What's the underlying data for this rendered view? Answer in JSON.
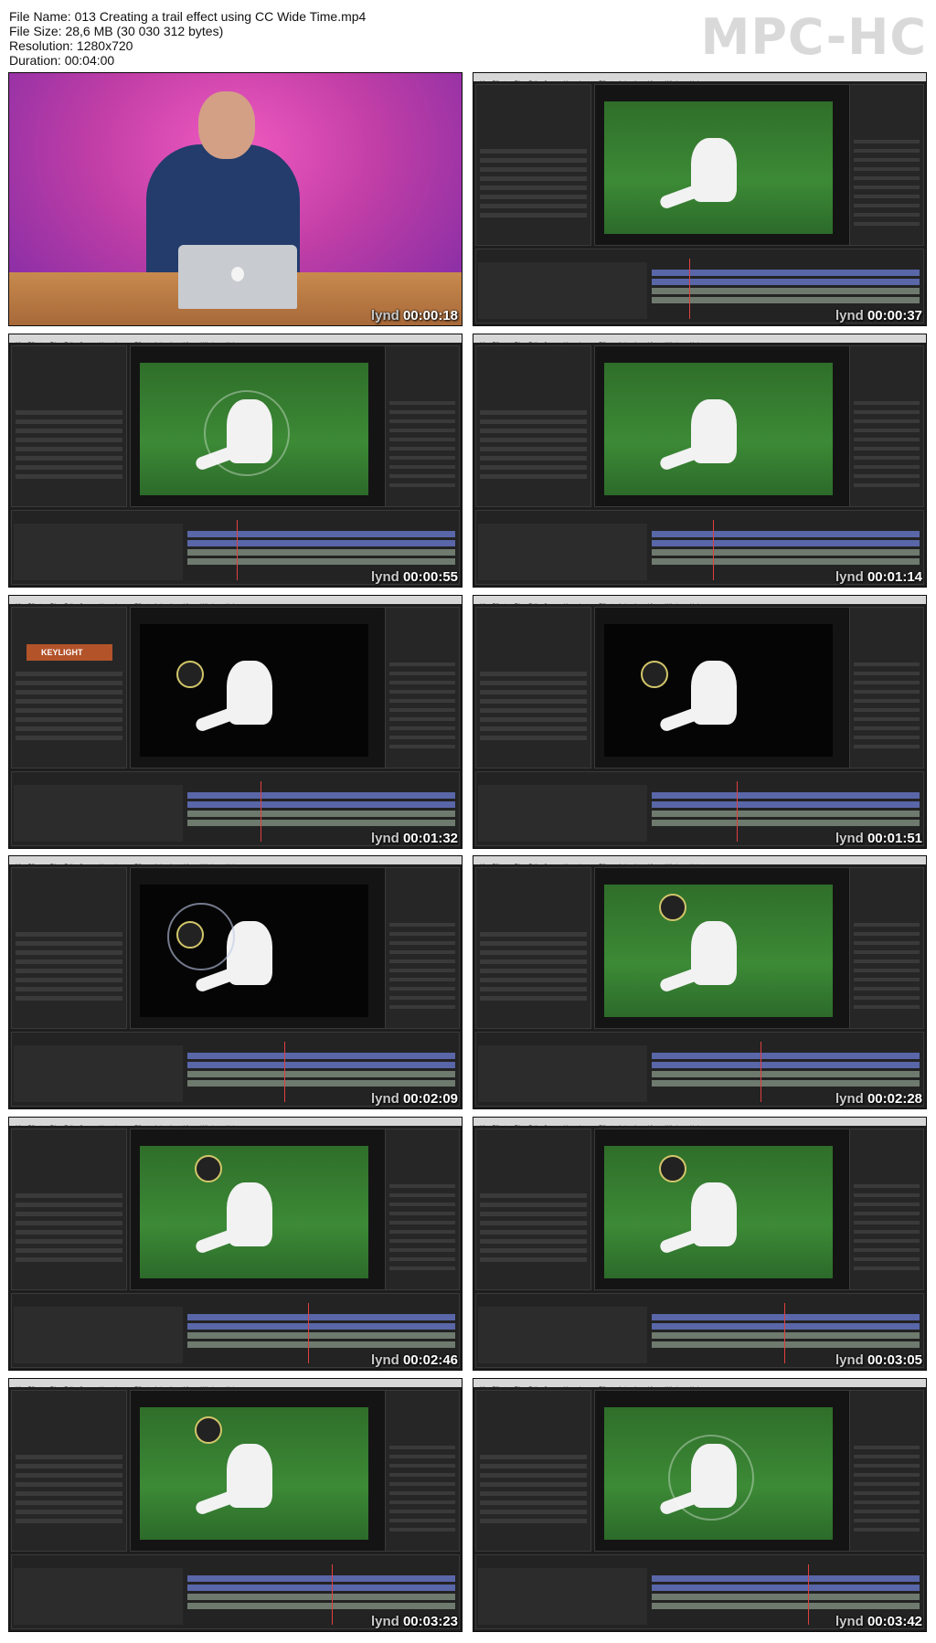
{
  "info": {
    "file_name": "File Name: 013 Creating a trail effect using CC Wide Time.mp4",
    "file_size": "File Size: 28,6 MB (30 030 312 bytes)",
    "resolution": "Resolution: 1280x720",
    "duration": "Duration: 00:04:00"
  },
  "brand": "MPC-HC",
  "ae": {
    "menu": [
      "After Effects",
      "File",
      "Edit",
      "Composition",
      "Layer",
      "Effect",
      "Animation",
      "View",
      "Window",
      "Help"
    ],
    "keylight_label": "KEYLIGHT"
  },
  "watermark": "lynda.com",
  "thumbnails": [
    {
      "time": "00:00:18",
      "scene": "presenter"
    },
    {
      "time": "00:00:37",
      "scene": "grass"
    },
    {
      "time": "00:00:55",
      "scene": "grass-trail"
    },
    {
      "time": "00:01:14",
      "scene": "grass"
    },
    {
      "time": "00:01:32",
      "scene": "black-keylight"
    },
    {
      "time": "00:01:51",
      "scene": "black"
    },
    {
      "time": "00:02:09",
      "scene": "black-circle"
    },
    {
      "time": "00:02:28",
      "scene": "grass-ball"
    },
    {
      "time": "00:02:46",
      "scene": "grass-ball"
    },
    {
      "time": "00:03:05",
      "scene": "grass-ball"
    },
    {
      "time": "00:03:23",
      "scene": "grass-ball"
    },
    {
      "time": "00:03:42",
      "scene": "grass-trail"
    }
  ],
  "colors": {
    "ae_panel": "#262626",
    "timeline_blue": "#5966a8",
    "playhead": "#e04040",
    "keylight": "#b3532a"
  }
}
